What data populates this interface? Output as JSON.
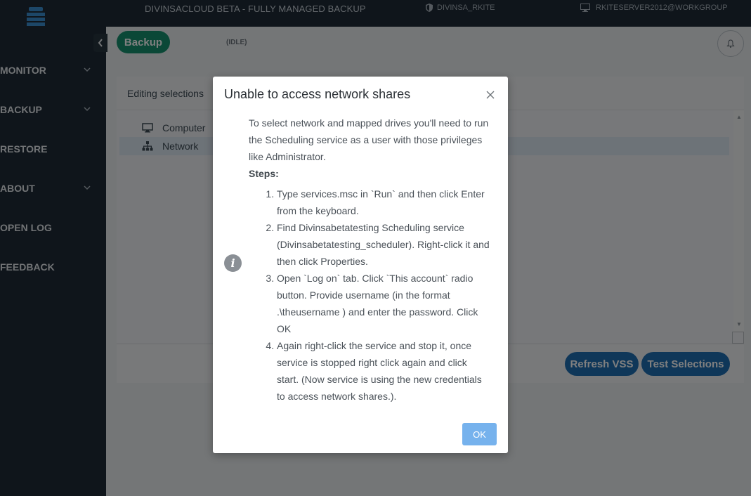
{
  "topbar": {
    "app_title": "DIVINSACLOUD BETA - FULLY MANAGED BACKUP",
    "user": "DIVINSA_RKITE",
    "server": "RKITESERVER2012@WORKGROUP"
  },
  "sidebar": {
    "items": [
      {
        "label": "MONITOR",
        "has_chevron": true
      },
      {
        "label": "BACKUP",
        "has_chevron": true
      },
      {
        "label": "RESTORE",
        "has_chevron": false
      },
      {
        "label": "ABOUT",
        "has_chevron": true
      },
      {
        "label": "OPEN LOG",
        "has_chevron": false
      },
      {
        "label": "FEEDBACK",
        "has_chevron": false
      }
    ]
  },
  "header": {
    "backup_label": "Backup",
    "status": "(IDLE)"
  },
  "panel": {
    "title": "Editing selections",
    "tree": [
      {
        "label": "Computer",
        "icon": "monitor-icon",
        "selected": false
      },
      {
        "label": "Network",
        "icon": "network-icon",
        "selected": true
      }
    ],
    "refresh_vss_label": "Refresh VSS",
    "test_selections_label": "Test Selections"
  },
  "modal": {
    "title": "Unable to access network shares",
    "intro": "To select network and mapped drives you'll need to run the Scheduling service as a user with those privileges like Administrator.",
    "steps_heading": "Steps:",
    "steps": [
      "Type services.msc in `Run` and then click Enter from the keyboard.",
      "Find Divinsabetatesting Scheduling service (Divinsabetatesting_scheduler). Right-click it and then click Properties.",
      "Open `Log on` tab. Click `This account` radio button. Provide username (in the format .\\theusername ) and enter the password. Click OK",
      "Again right-click the service and stop it, once service is stopped right click again and click start. (Now service is using the new credentials to access network shares.)."
    ],
    "ok_label": "OK"
  },
  "colors": {
    "sidebar_bg": "#1e2a36",
    "backup_green": "#17916f",
    "button_blue": "#1f6fb2",
    "ok_blue": "#76b2ed"
  }
}
